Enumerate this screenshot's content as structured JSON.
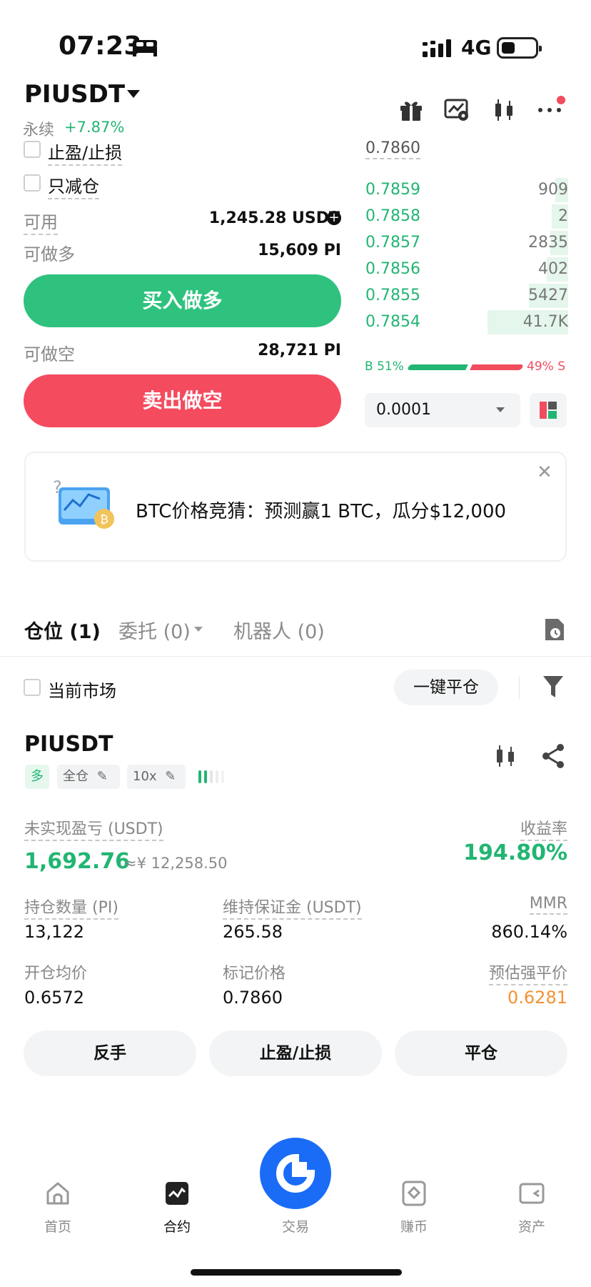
{
  "status_bar": {
    "time": "07:23",
    "network": "4G"
  },
  "header": {
    "pair": "PIUSDT",
    "contract_type": "永续",
    "change": "+7.87%"
  },
  "form": {
    "tpsl_label": "止盈/止损",
    "reduce_only_label": "只减仓",
    "available_label": "可用",
    "available_value": "1,245.28 USDT",
    "max_long_label": "可做多",
    "max_long_value": "15,609 PI",
    "buy_label": "买入做多",
    "max_short_label": "可做空",
    "max_short_value": "28,721 PI",
    "sell_label": "卖出做空"
  },
  "orderbook": {
    "last_price": "0.7860",
    "bids": [
      {
        "price": "0.7859",
        "qty": "909",
        "depth": 0.07
      },
      {
        "price": "0.7858",
        "qty": "2",
        "depth": 0.09
      },
      {
        "price": "0.7857",
        "qty": "2835",
        "depth": 0.1
      },
      {
        "price": "0.7856",
        "qty": "402",
        "depth": 0.12
      },
      {
        "price": "0.7855",
        "qty": "5427",
        "depth": 0.22
      },
      {
        "price": "0.7854",
        "qty": "41.7K",
        "depth": 0.45
      }
    ],
    "buy_ratio": "B 51%",
    "sell_ratio": "49% S",
    "precision": "0.0001"
  },
  "banner": {
    "text": "BTC价格竞猜：预测赢1 BTC，瓜分$12,000"
  },
  "tabs": {
    "positions": "仓位 (1)",
    "orders": "委托 (0)",
    "bots": "机器人 (0)"
  },
  "filter": {
    "current_market": "当前市场",
    "close_all": "一键平仓"
  },
  "position": {
    "symbol": "PIUSDT",
    "side": "多",
    "margin_mode": "全仓",
    "leverage": "10x",
    "unrealized_pnl_label": "未实现盈亏 (USDT)",
    "unrealized_pnl": "1,692.76",
    "unrealized_pnl_cny": "≈¥ 12,258.50",
    "roe_label": "收益率",
    "roe": "194.80%",
    "size_label": "持仓数量 (PI)",
    "size": "13,122",
    "maint_margin_label": "维持保证金 (USDT)",
    "maint_margin": "265.58",
    "mmr_label": "MMR",
    "mmr": "860.14%",
    "entry_price_label": "开仓均价",
    "entry_price": "0.6572",
    "mark_price_label": "标记价格",
    "mark_price": "0.7860",
    "liq_price_label": "预估强平价",
    "liq_price": "0.6281"
  },
  "actions": {
    "reverse": "反手",
    "tpsl": "止盈/止损",
    "close": "平仓"
  },
  "nav": {
    "home": "首页",
    "futures": "合约",
    "trade": "交易",
    "earn": "赚币",
    "assets": "资产"
  }
}
